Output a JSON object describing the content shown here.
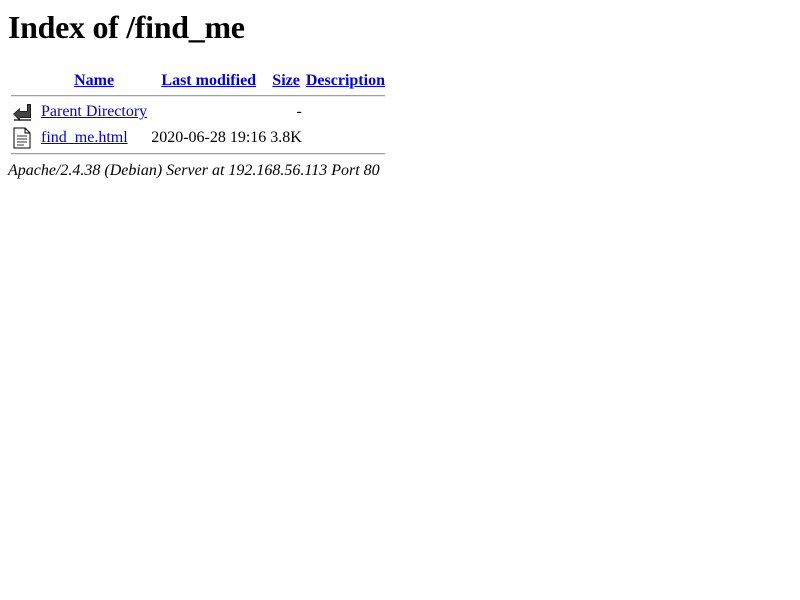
{
  "page": {
    "title": "Index of /find_me"
  },
  "table": {
    "headers": {
      "name": "Name",
      "last_modified": "Last modified",
      "size": "Size",
      "description": "Description"
    },
    "rows": [
      {
        "icon": "back-arrow-icon",
        "name": "Parent Directory",
        "last_modified": "",
        "size": "-",
        "description": ""
      },
      {
        "icon": "text-file-icon",
        "name": "find_me.html",
        "last_modified": "2020-06-28 19:16",
        "size": "3.8K",
        "description": ""
      }
    ]
  },
  "footer": {
    "server_signature": "Apache/2.4.38 (Debian) Server at 192.168.56.113 Port 80"
  },
  "colors": {
    "link": "#0000ee",
    "rule": "#a0a0a0"
  }
}
